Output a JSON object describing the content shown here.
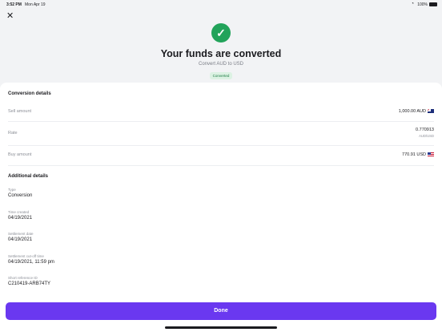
{
  "status_bar": {
    "time": "3:52 PM",
    "date": "Mon Apr 19",
    "battery": "100%"
  },
  "hero": {
    "title": "Your funds are converted",
    "subtitle": "Convert AUD to USD",
    "badge": "Converted"
  },
  "conversion": {
    "title": "Conversion details",
    "sell_label": "Sell amount",
    "sell_value": "1,000.00 AUD",
    "rate_label": "Rate",
    "rate_value": "0.770913",
    "rate_pair": "AUD/USD",
    "buy_label": "Buy amount",
    "buy_value": "770.91 USD"
  },
  "additional": {
    "title": "Additional details",
    "items": [
      {
        "label": "Type",
        "value": "Conversion"
      },
      {
        "label": "Time created",
        "value": "04/19/2021"
      },
      {
        "label": "Settlement date",
        "value": "04/19/2021"
      },
      {
        "label": "Settlement cut-off time",
        "value": "04/19/2021, 11:59 pm"
      },
      {
        "label": "Short reference ID",
        "value": "C210419-ARB74TY"
      }
    ]
  },
  "actions": {
    "done_label": "Done"
  },
  "colors": {
    "accent": "#6a38f0",
    "success": "#22a35a"
  }
}
